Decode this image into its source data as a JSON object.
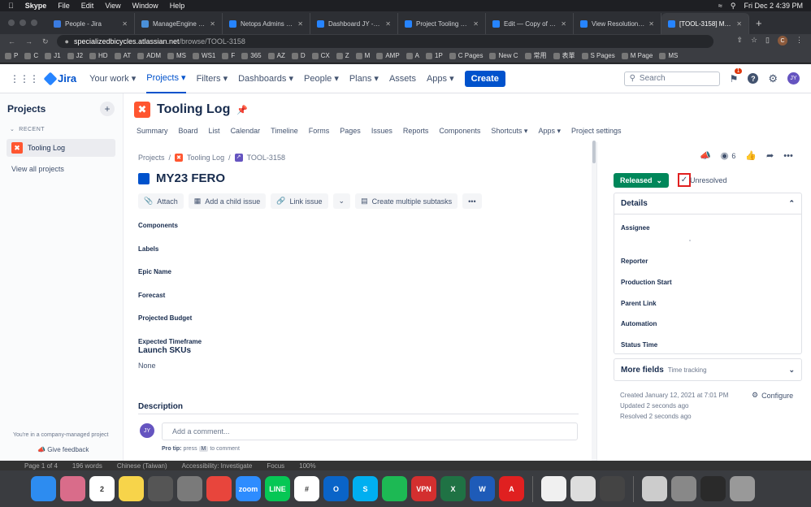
{
  "macmenu": {
    "app": "Skype",
    "items": [
      "File",
      "Edit",
      "View",
      "Window",
      "Help"
    ],
    "clock": "Fri Dec 2  4:39 PM"
  },
  "browser_tabs": [
    {
      "label": "People - Jira",
      "color": "#3a7be0"
    },
    {
      "label": "ManageEngine - ADM",
      "color": "#4a90d9"
    },
    {
      "label": "Netops Admins - Glo",
      "color": "#2684ff"
    },
    {
      "label": "Dashboard JY - Jira",
      "color": "#2684ff"
    },
    {
      "label": "Project Tooling Log -",
      "color": "#2684ff"
    },
    {
      "label": "Edit — Copy of TOOL",
      "color": "#2684ff"
    },
    {
      "label": "View Resolutions - Ji",
      "color": "#2684ff"
    },
    {
      "label": "[TOOL-3158] MY23 F",
      "color": "#2684ff"
    }
  ],
  "address": {
    "host": "specializedbicycles.atlassian.net",
    "path": "/browse/TOOL-3158"
  },
  "bookmarks": [
    "P",
    "C",
    "J1",
    "J2",
    "HD",
    "AT",
    "ADM",
    "MS",
    "WS1",
    "F",
    "365",
    "AZ",
    "D",
    "CX",
    "Z",
    "M",
    "AMP",
    "A",
    "1P",
    "C Pages",
    "New C",
    "常用",
    "表單",
    "S Pages",
    "M Page",
    "MS"
  ],
  "jira_nav": {
    "logo": "Jira",
    "items": [
      "Your work",
      "Projects",
      "Filters",
      "Dashboards",
      "People",
      "Plans",
      "Assets",
      "Apps"
    ],
    "active": "Projects",
    "create": "Create",
    "search_placeholder": "Search",
    "notif_count": "1",
    "user_initials": "JY"
  },
  "sidebar": {
    "title": "Projects",
    "recent_label": "RECENT",
    "recent_item": "Tooling Log",
    "view_all": "View all projects",
    "footer_note": "You're in a company-managed project",
    "feedback": "Give feedback"
  },
  "project": {
    "name": "Tooling Log",
    "tabs": [
      "Summary",
      "Board",
      "List",
      "Calendar",
      "Timeline",
      "Forms",
      "Pages",
      "Issues",
      "Reports",
      "Components",
      "Shortcuts",
      "Apps",
      "Project settings"
    ]
  },
  "issue": {
    "breadcrumb": [
      "Projects",
      "Tooling Log",
      "TOOL-3158"
    ],
    "title": "MY23 FERO",
    "actions": [
      "Attach",
      "Add a child issue",
      "Link issue",
      "Create multiple subtasks"
    ],
    "fields": [
      "Components",
      "Labels",
      "Epic Name",
      "Forecast",
      "Projected Budget",
      "Expected Timeframe"
    ],
    "launch_skus_label": "Launch SKUs",
    "launch_skus_value": "None",
    "description_label": "Description",
    "comment_placeholder": "Add a comment...",
    "protip_label": "Pro tip:",
    "protip_press": "press",
    "protip_key": "M",
    "protip_suffix": "to comment"
  },
  "right_panel": {
    "watch_count": "6",
    "status": "Released",
    "resolution": "Unresolved",
    "details_label": "Details",
    "detail_fields": [
      "Assignee",
      "Reporter",
      "Production Start",
      "Parent Link",
      "Automation",
      "Status Time"
    ],
    "more_fields": "More fields",
    "more_fields_sub": "Time tracking",
    "created": "Created January 12, 2021 at 7:01 PM",
    "updated": "Updated 2 seconds ago",
    "resolved": "Resolved 2 seconds ago",
    "configure": "Configure"
  },
  "statusbar": [
    "Page 1 of 4",
    "196 words",
    "Chinese (Taiwan)",
    "Accessibility: Investigate",
    "Focus",
    "100%"
  ],
  "dock": [
    {
      "name": "finder",
      "color": "#2d8cf0",
      "label": ""
    },
    {
      "name": "launchpad",
      "color": "#d96c8a",
      "label": ""
    },
    {
      "name": "calendar",
      "color": "#ffffff",
      "label": "2"
    },
    {
      "name": "notes",
      "color": "#f7d44a",
      "label": ""
    },
    {
      "name": "calculator",
      "color": "#555555",
      "label": ""
    },
    {
      "name": "system-preferences",
      "color": "#7a7a7a",
      "label": ""
    },
    {
      "name": "chrome",
      "color": "#e8453c",
      "label": ""
    },
    {
      "name": "zoom",
      "color": "#2d8cff",
      "label": "zoom"
    },
    {
      "name": "line",
      "color": "#06c755",
      "label": "LINE"
    },
    {
      "name": "slack",
      "color": "#ffffff",
      "label": "#"
    },
    {
      "name": "outlook",
      "color": "#0a64c8",
      "label": "O"
    },
    {
      "name": "skype",
      "color": "#00aff0",
      "label": "S"
    },
    {
      "name": "spotify",
      "color": "#1db954",
      "label": ""
    },
    {
      "name": "vpn",
      "color": "#d32f2f",
      "label": "VPN"
    },
    {
      "name": "excel",
      "color": "#1f7244",
      "label": "X"
    },
    {
      "name": "word",
      "color": "#1e5bb8",
      "label": "W"
    },
    {
      "name": "acrobat",
      "color": "#e02020",
      "label": "A"
    },
    {
      "name": "document",
      "color": "#f0f0f0",
      "label": ""
    },
    {
      "name": "help",
      "color": "#dddddd",
      "label": ""
    },
    {
      "name": "recorder",
      "color": "#444444",
      "label": ""
    },
    {
      "name": "window1",
      "color": "#cccccc",
      "label": ""
    },
    {
      "name": "window2",
      "color": "#888888",
      "label": ""
    },
    {
      "name": "window3",
      "color": "#2a2a2a",
      "label": ""
    },
    {
      "name": "trash",
      "color": "#999999",
      "label": ""
    }
  ]
}
